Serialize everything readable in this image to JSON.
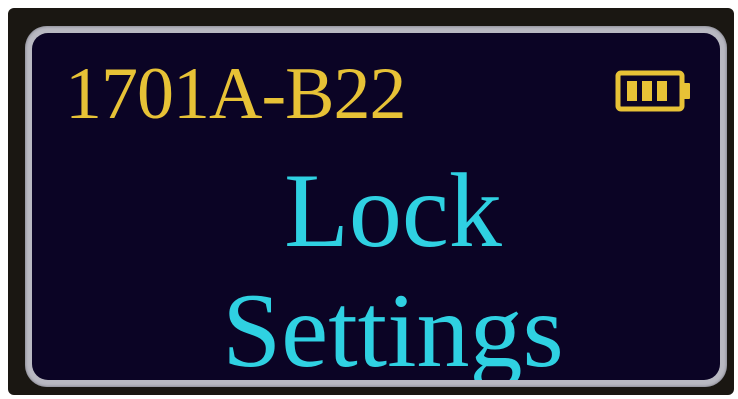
{
  "screen": {
    "device_id": "1701A-B22",
    "title_line_1": "Lock",
    "title_line_2": "Settings",
    "battery": {
      "icon": "battery-icon",
      "bars_shown": 3,
      "color": "#e7c236"
    }
  },
  "colors": {
    "screen_background": "#0b0425",
    "device_id_text": "#e7c236",
    "title_text": "#2fd1e2",
    "bezel": "#b9b9c2"
  }
}
